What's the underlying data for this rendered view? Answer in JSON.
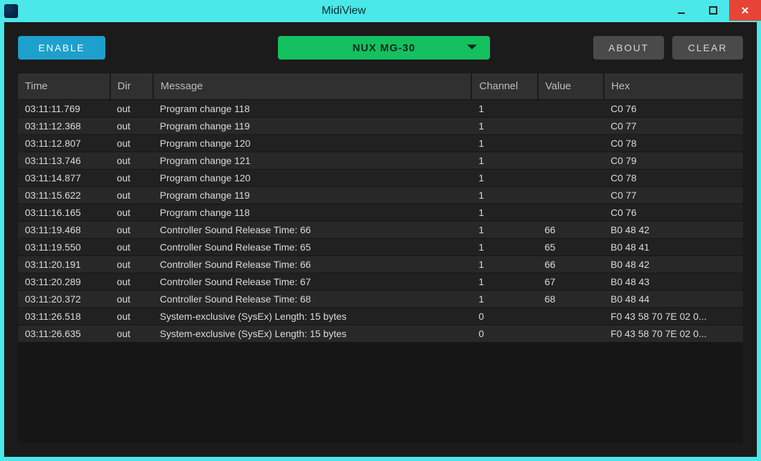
{
  "window": {
    "title": "MidiView"
  },
  "toolbar": {
    "enable_label": "ENABLE",
    "about_label": "ABOUT",
    "clear_label": "CLEAR",
    "device_selected": "NUX MG-30"
  },
  "table": {
    "headers": {
      "time": "Time",
      "dir": "Dir",
      "message": "Message",
      "channel": "Channel",
      "value": "Value",
      "hex": "Hex"
    },
    "rows": [
      {
        "time": "03:11:11.769",
        "dir": "out",
        "message": "Program change 118",
        "channel": "1",
        "value": "",
        "hex": "C0 76"
      },
      {
        "time": "03:11:12.368",
        "dir": "out",
        "message": "Program change 119",
        "channel": "1",
        "value": "",
        "hex": "C0 77"
      },
      {
        "time": "03:11:12.807",
        "dir": "out",
        "message": "Program change 120",
        "channel": "1",
        "value": "",
        "hex": "C0 78"
      },
      {
        "time": "03:11:13.746",
        "dir": "out",
        "message": "Program change 121",
        "channel": "1",
        "value": "",
        "hex": "C0 79"
      },
      {
        "time": "03:11:14.877",
        "dir": "out",
        "message": "Program change 120",
        "channel": "1",
        "value": "",
        "hex": "C0 78"
      },
      {
        "time": "03:11:15.622",
        "dir": "out",
        "message": "Program change 119",
        "channel": "1",
        "value": "",
        "hex": "C0 77"
      },
      {
        "time": "03:11:16.165",
        "dir": "out",
        "message": "Program change 118",
        "channel": "1",
        "value": "",
        "hex": "C0 76"
      },
      {
        "time": "03:11:19.468",
        "dir": "out",
        "message": "Controller Sound Release Time: 66",
        "channel": "1",
        "value": "66",
        "hex": "B0 48 42"
      },
      {
        "time": "03:11:19.550",
        "dir": "out",
        "message": "Controller Sound Release Time: 65",
        "channel": "1",
        "value": "65",
        "hex": "B0 48 41"
      },
      {
        "time": "03:11:20.191",
        "dir": "out",
        "message": "Controller Sound Release Time: 66",
        "channel": "1",
        "value": "66",
        "hex": "B0 48 42"
      },
      {
        "time": "03:11:20.289",
        "dir": "out",
        "message": "Controller Sound Release Time: 67",
        "channel": "1",
        "value": "67",
        "hex": "B0 48 43"
      },
      {
        "time": "03:11:20.372",
        "dir": "out",
        "message": "Controller Sound Release Time: 68",
        "channel": "1",
        "value": "68",
        "hex": "B0 48 44"
      },
      {
        "time": "03:11:26.518",
        "dir": "out",
        "message": "System-exclusive (SysEx) Length: 15 bytes",
        "channel": "0",
        "value": "",
        "hex": "F0 43 58 70 7E 02 0..."
      },
      {
        "time": "03:11:26.635",
        "dir": "out",
        "message": "System-exclusive (SysEx) Length: 15 bytes",
        "channel": "0",
        "value": "",
        "hex": "F0 43 58 70 7E 02 0..."
      }
    ]
  }
}
